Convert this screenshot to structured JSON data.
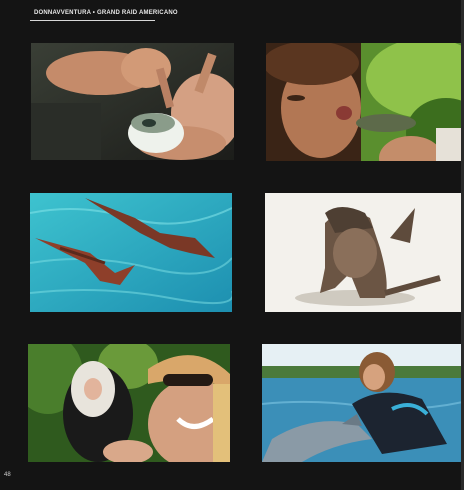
{
  "header": {
    "brand": "DONNAVVENTURA",
    "separator": " • ",
    "section": "GRAND RAID AMERICANO"
  },
  "page_number": "48"
}
